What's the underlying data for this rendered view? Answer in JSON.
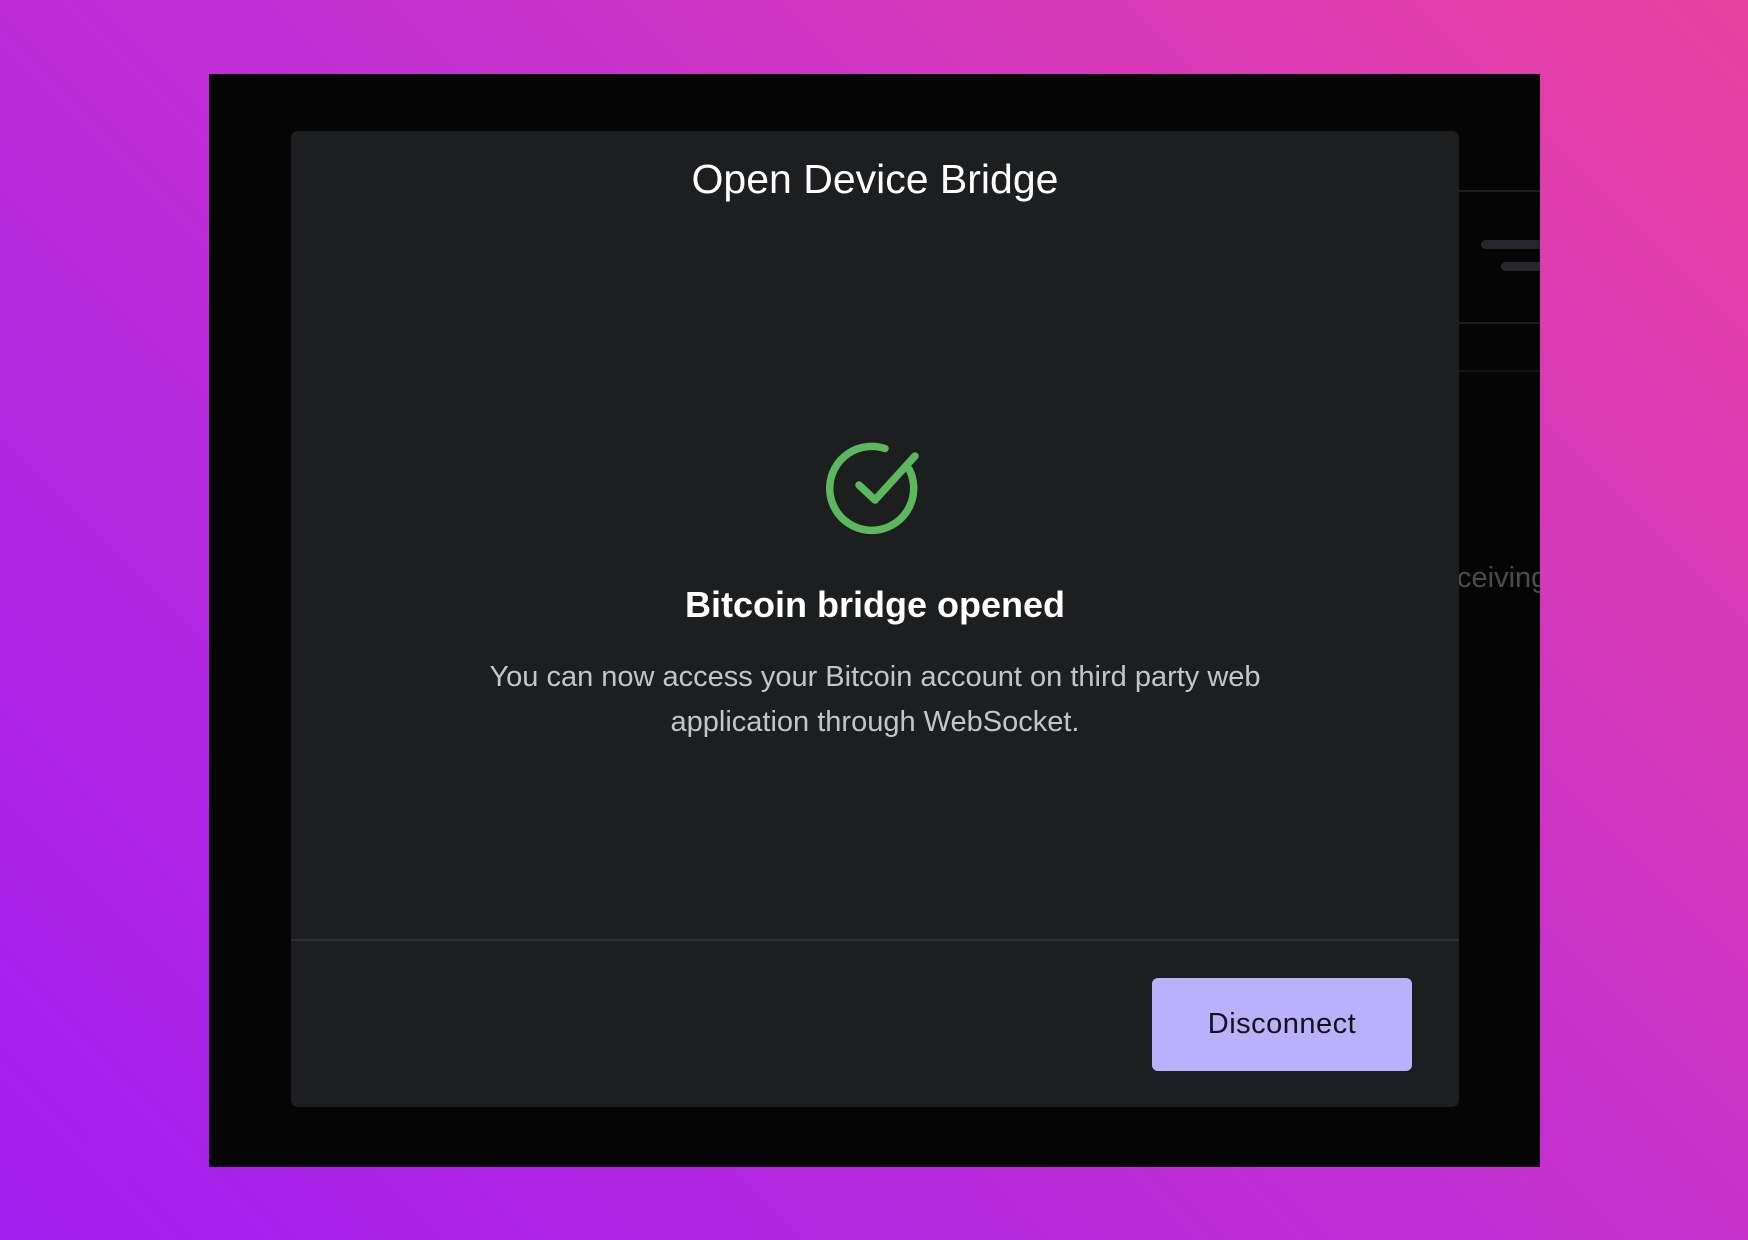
{
  "modal": {
    "title": "Open Device Bridge",
    "status_icon": "check-circle-icon",
    "status_title": "Bitcoin bridge opened",
    "status_description": "You can now access your Bitcoin account on third party web application through WebSocket.",
    "disconnect_label": "Disconnect"
  },
  "background_app": {
    "partial_text": "ceiving"
  },
  "colors": {
    "success": "#5cb85c",
    "button_accent": "#bbb0fb",
    "modal_bg": "#1d1e20"
  }
}
